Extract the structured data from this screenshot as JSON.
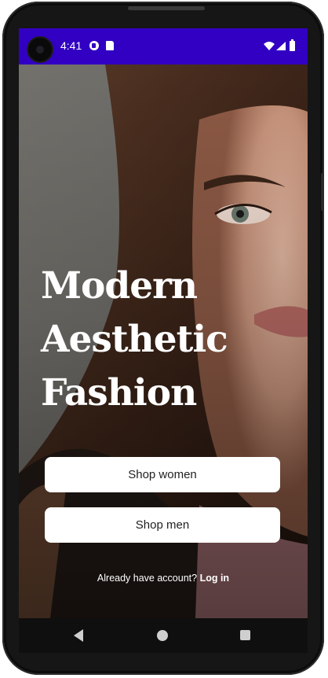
{
  "status_bar": {
    "time": "4:41",
    "background_color": "#3200c2",
    "icons": [
      "notification-icon",
      "sim-icon",
      "wifi-icon",
      "signal-icon",
      "battery-icon"
    ]
  },
  "hero": {
    "headline_lines": [
      "Modern",
      "Aesthetic",
      "Fashion"
    ],
    "image": "portrait-photo"
  },
  "actions": {
    "shop_women_label": "Shop women",
    "shop_men_label": "Shop men"
  },
  "login": {
    "prompt": "Already have account? ",
    "link_label": "Log in"
  },
  "nav_bar": {
    "icons": [
      "back-icon",
      "home-icon",
      "recents-icon"
    ]
  }
}
